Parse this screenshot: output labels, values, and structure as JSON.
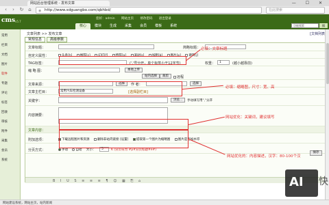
{
  "browser": {
    "tab_title": "网站后台管理系统 - 发布文章",
    "url": "http://www.sdguangbo.com/qbhbd/",
    "search_placeholder": "在此搜索",
    "controls": "— ☐ ✕"
  },
  "cms": {
    "logo": "cms",
    "version": "v5.7",
    "top_links": [
      "您好：admin",
      "网站主页",
      "修改密码",
      "退出登录"
    ],
    "nav_tabs": [
      "核心",
      "模块",
      "生成",
      "采集",
      "会员",
      "模板",
      "系统"
    ],
    "active_tab": 0,
    "quick_search_placeholder": "功能搜索",
    "quick_search_button": "搜"
  },
  "sidebar": {
    "items": [
      "常用",
      "栏目",
      "文档",
      "图片",
      "软件",
      "专题",
      "评论",
      "标签",
      "回收",
      "审核",
      "附件",
      "采集",
      "会员",
      "系统"
    ]
  },
  "breadcrumb": "文章列表 >> 发布文章",
  "breadcrumb_right": "[文档列表]",
  "form_tabs": [
    "常规信息",
    "高级参数"
  ],
  "form": {
    "title_label": "文章标题：",
    "short_title_label": "简略标题：",
    "attr_label": "自定义属性：",
    "attrs": [
      "头条[h]",
      "推荐[c]",
      "幻灯[f]",
      "特荐[a]",
      "滚动[s]",
      "加粗[b]",
      "图片[p]",
      "跳转[j]"
    ],
    "tag_label": "TAG标签：",
    "tag_hint": "(','号分开，单个标签小于12字节)",
    "weight_label": "权重：",
    "weight_value": "1",
    "weight_hint": "(越小越靠前)",
    "thumb_label": "缩 略 图：",
    "upload_button": "本地上传",
    "select_button": "站内选择",
    "crop_button": "裁剪",
    "remote_label": "远程",
    "source_label": "文章来源：",
    "source_button": "选择",
    "author_label": "作 者：",
    "author_button": "选择",
    "column_label": "文章主栏目：",
    "column_value": "常用汽车检测设备",
    "column_button": "[选择副栏目]",
    "keywords_label": "关键字：",
    "keywords_button": "浏览...",
    "keywords_hint": "手动填写用\",\"分开",
    "summary_label": "内容摘要：",
    "content_label": "文章内容：",
    "attach_label": "附加选项：",
    "attach_opts": [
      "下载远程图片和资源",
      "删除非站内链接 [设置]",
      "提取第一个图片为缩略图",
      "图片是否加水印"
    ],
    "page_label": "分页方式：",
    "page_opts": [
      "手动",
      "自动"
    ],
    "page_size_label": "大小：",
    "page_size": "5",
    "page_hint": "K (分页符为 #p#分页标题#e#)",
    "save_button": "保存"
  },
  "annotations": [
    "必填：文章标题",
    "必填：缩略图，尺寸：宽、高",
    "网站优化：关键词，建议填写",
    "网站优化的：内容描述，汉字：80-100个汉"
  ],
  "editor_icons": "B I U S ≡ ≡ ≡ ¶ ☺ ▦ ⎘ ⌂",
  "watermark": "AI",
  "watermark_side": "快",
  "status": "网站建设系统，网站主页，站内新闻"
}
